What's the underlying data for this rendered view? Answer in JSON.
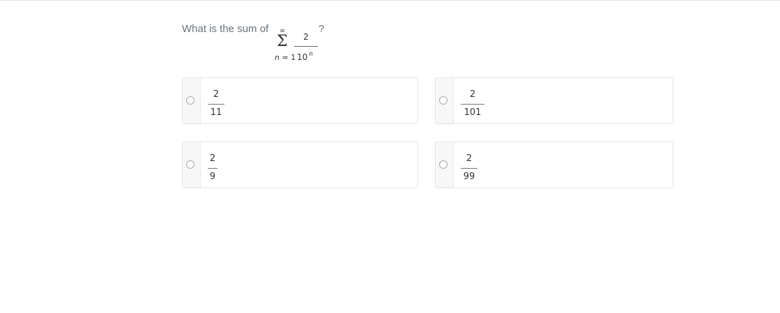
{
  "question": {
    "prefix": "What is the sum of",
    "sum_upper": "∞",
    "sum_symbol": "Σ",
    "sum_lower_var": "n",
    "sum_lower_eq": " = 1",
    "term_numerator": "2",
    "term_denominator_base": "10",
    "term_denominator_exp": "n",
    "suffix": "?"
  },
  "options": [
    {
      "numerator": "2",
      "denominator": "11"
    },
    {
      "numerator": "2",
      "denominator": "101"
    },
    {
      "numerator": "2",
      "denominator": "9"
    },
    {
      "numerator": "2",
      "denominator": "99"
    }
  ]
}
